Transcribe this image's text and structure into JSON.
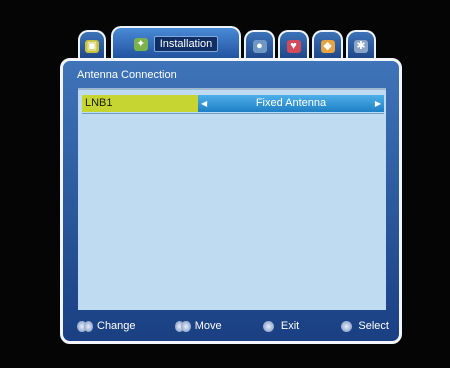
{
  "tabs": [
    {
      "icon": "tv-icon",
      "glyph": "▣",
      "color": "#c5c23c",
      "label": ""
    },
    {
      "icon": "satellite-icon",
      "glyph": "✦",
      "color": "#7cb24a",
      "label": "Installation"
    },
    {
      "icon": "media-icon",
      "glyph": "●",
      "color": "#a6c8e6",
      "label": ""
    },
    {
      "icon": "heart-icon",
      "glyph": "♥",
      "color": "#d24a5c",
      "label": ""
    },
    {
      "icon": "settings-icon",
      "glyph": "◆",
      "color": "#e7a241",
      "label": ""
    },
    {
      "icon": "info-icon",
      "glyph": "✱",
      "color": "#cfd8e8",
      "label": ""
    }
  ],
  "panel": {
    "title": "Antenna Connection",
    "row": {
      "label": "LNB1",
      "value": "Fixed Antenna"
    }
  },
  "help": {
    "change": "Change",
    "move": "Move",
    "exit": "Exit",
    "select": "Select"
  }
}
